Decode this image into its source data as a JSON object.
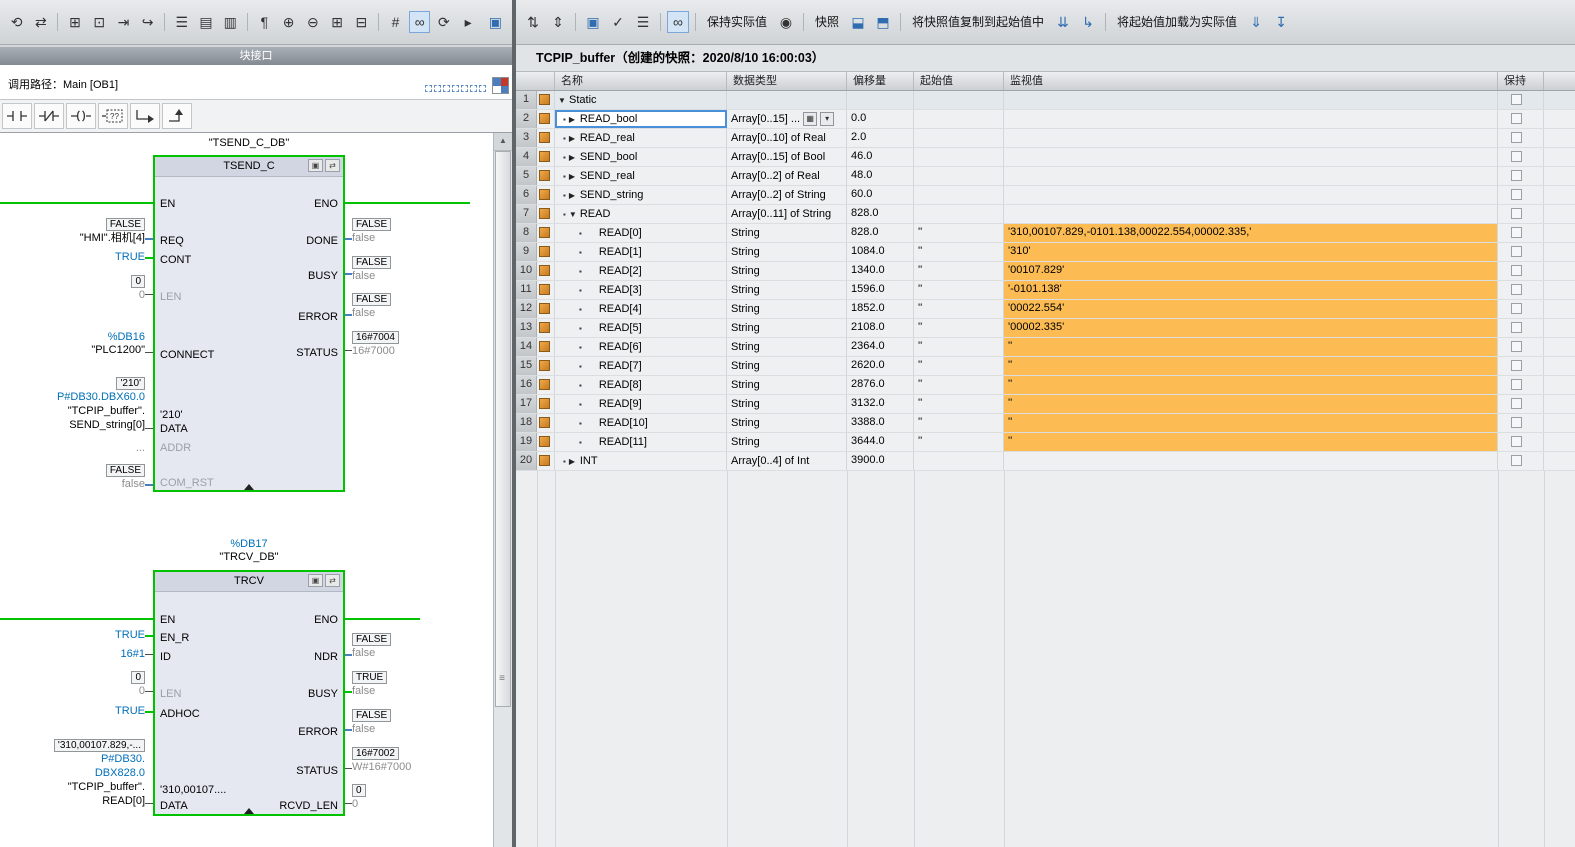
{
  "icons": {
    "update-call": "⟲",
    "consistency": "⇄",
    "insert-network": "⊞",
    "insert-box": "⊡",
    "goto": "⇥",
    "navigate": "↪",
    "align-left": "☰",
    "align-center": "▤",
    "align-right": "▥",
    "comment": "¶",
    "expand-all": "⊕",
    "collapse-all": "⊖",
    "expand-boxes": "⊞",
    "collapse-boxes": "⊟",
    "abs-operands": "#",
    "monitor": "∞",
    "refresh": "⟳",
    "more": "▸",
    "editor-settings": "▣",
    "sort-up": "⇅",
    "sort-down": "⇕",
    "keep-cube": "▣",
    "apply-check": "✓",
    "list": "☰",
    "lock": "◉",
    "snapshot-make": "⬓",
    "snapshot-load": "⬒",
    "copy-1": "⇊",
    "copy-2": "↳",
    "load-1": "⇓",
    "load-2": "↧",
    "camera": "▣",
    "plug": "⇄",
    "up-arrow": "▲",
    "grip": "≡"
  },
  "left_panel": {
    "interface_bar_label": "块接口",
    "call_path": "调用路径：Main [OB1]",
    "favorites": {
      "empty_box_label": "??"
    },
    "ladder": {
      "tsend": {
        "instance": "\"TSEND_C_DB\"",
        "title": "TSEND_C",
        "pins_left": [
          "EN",
          "REQ",
          "CONT",
          "LEN",
          "CONNECT",
          "DATA",
          "ADDR",
          "COM_RST"
        ],
        "pins_right": [
          "ENO",
          "DONE",
          "BUSY",
          "ERROR",
          "STATUS"
        ],
        "inline_data_value": "'210'",
        "req": {
          "box": "FALSE",
          "name": "\"HMI\".相机[4]"
        },
        "cont": "TRUE",
        "len": {
          "box": "0",
          "sub": "0"
        },
        "connect": {
          "db": "%DB16",
          "name": "\"PLC1200\""
        },
        "data": {
          "box": "'210'",
          "ptr": "P#DB30.DBX60.0",
          "l1": "\"TCPIP_buffer\".",
          "l2": "SEND_string[0]"
        },
        "addr": "...",
        "com_rst": {
          "box": "FALSE",
          "sub": "false"
        },
        "done": {
          "box": "FALSE",
          "sub": "false"
        },
        "busy": {
          "box": "FALSE",
          "sub": "false"
        },
        "error": {
          "box": "FALSE",
          "sub": "false"
        },
        "status": {
          "box": "16#7004",
          "sub": "16#7000"
        }
      },
      "trcv": {
        "db": "%DB17",
        "instance": "\"TRCV_DB\"",
        "title": "TRCV",
        "pins_left": [
          "EN",
          "EN_R",
          "ID",
          "LEN",
          "ADHOC",
          "DATA"
        ],
        "pins_right": [
          "ENO",
          "NDR",
          "BUSY",
          "ERROR",
          "STATUS",
          "RCVD_LEN"
        ],
        "inline_data_value": "'310,00107....",
        "en_r": "TRUE",
        "id": "16#1",
        "len": {
          "box": "0",
          "sub": "0"
        },
        "adhoc": "TRUE",
        "data": {
          "box": "'310,00107.829,-...",
          "p1": "P#DB30.",
          "p2": "DBX828.0",
          "l1": "\"TCPIP_buffer\".",
          "l2": "READ[0]"
        },
        "ndr": {
          "box": "FALSE",
          "sub": "false"
        },
        "busy": {
          "box": "TRUE",
          "sub": "false"
        },
        "error": {
          "box": "FALSE",
          "sub": "false"
        },
        "status": {
          "box": "16#7002",
          "sub": "W#16#7000"
        },
        "rcvd_len": {
          "box": "0",
          "sub": "0"
        }
      }
    }
  },
  "right_panel": {
    "toolbar": {
      "keep_actual": "保持实际值",
      "snapshot": "快照",
      "copy_snapshot_to_start": "将快照值复制到起始值中",
      "load_start_as_actual": "将起始值加载为实际值"
    },
    "title": "TCPIP_buffer（创建的快照：2020/8/10 16:00:03）",
    "table": {
      "headers": {
        "name": "名称",
        "datatype": "数据类型",
        "offset": "偏移量",
        "start": "起始值",
        "monitor": "监视值",
        "retain": "保持"
      },
      "rows": [
        {
          "num": "1",
          "level": 0,
          "expander": "down",
          "name": "Static",
          "datatype": "",
          "offset": "",
          "start": "",
          "monitor": "",
          "tint": true
        },
        {
          "num": "2",
          "level": 1,
          "bullet": true,
          "expander": "right",
          "name": "READ_bool",
          "datatype": "Array[0..15] ...",
          "offset": "0.0",
          "start": "",
          "monitor": "",
          "selected": true,
          "combo": true
        },
        {
          "num": "3",
          "level": 1,
          "bullet": true,
          "expander": "right",
          "name": "READ_real",
          "datatype": "Array[0..10] of Real",
          "offset": "2.0",
          "start": "",
          "monitor": ""
        },
        {
          "num": "4",
          "level": 1,
          "bullet": true,
          "expander": "right",
          "name": "SEND_bool",
          "datatype": "Array[0..15] of Bool",
          "offset": "46.0",
          "start": "",
          "monitor": ""
        },
        {
          "num": "5",
          "level": 1,
          "bullet": true,
          "expander": "right",
          "name": "SEND_real",
          "datatype": "Array[0..2] of Real",
          "offset": "48.0",
          "start": "",
          "monitor": ""
        },
        {
          "num": "6",
          "level": 1,
          "bullet": true,
          "expander": "right",
          "name": "SEND_string",
          "datatype": "Array[0..2] of String",
          "offset": "60.0",
          "start": "",
          "monitor": ""
        },
        {
          "num": "7",
          "level": 1,
          "bullet": true,
          "expander": "down",
          "name": "READ",
          "datatype": "Array[0..11] of String",
          "offset": "828.0",
          "start": "",
          "monitor": ""
        },
        {
          "num": "8",
          "level": 2,
          "bullet": true,
          "name": "READ[0]",
          "datatype": "String",
          "offset": "828.0",
          "start": "''",
          "monitor": "'310,00107.829,-0101.138,00022.554,00002.335,'",
          "highlight": true
        },
        {
          "num": "9",
          "level": 2,
          "bullet": true,
          "name": "READ[1]",
          "datatype": "String",
          "offset": "1084.0",
          "start": "''",
          "monitor": "'310'",
          "highlight": true
        },
        {
          "num": "10",
          "level": 2,
          "bullet": true,
          "name": "READ[2]",
          "datatype": "String",
          "offset": "1340.0",
          "start": "''",
          "monitor": "'00107.829'",
          "highlight": true
        },
        {
          "num": "11",
          "level": 2,
          "bullet": true,
          "name": "READ[3]",
          "datatype": "String",
          "offset": "1596.0",
          "start": "''",
          "monitor": "'-0101.138'",
          "highlight": true
        },
        {
          "num": "12",
          "level": 2,
          "bullet": true,
          "name": "READ[4]",
          "datatype": "String",
          "offset": "1852.0",
          "start": "''",
          "monitor": "'00022.554'",
          "highlight": true
        },
        {
          "num": "13",
          "level": 2,
          "bullet": true,
          "name": "READ[5]",
          "datatype": "String",
          "offset": "2108.0",
          "start": "''",
          "monitor": "'00002.335'",
          "highlight": true
        },
        {
          "num": "14",
          "level": 2,
          "bullet": true,
          "name": "READ[6]",
          "datatype": "String",
          "offset": "2364.0",
          "start": "''",
          "monitor": "''",
          "highlight": true
        },
        {
          "num": "15",
          "level": 2,
          "bullet": true,
          "name": "READ[7]",
          "datatype": "String",
          "offset": "2620.0",
          "start": "''",
          "monitor": "''",
          "highlight": true
        },
        {
          "num": "16",
          "level": 2,
          "bullet": true,
          "name": "READ[8]",
          "datatype": "String",
          "offset": "2876.0",
          "start": "''",
          "monitor": "''",
          "highlight": true
        },
        {
          "num": "17",
          "level": 2,
          "bullet": true,
          "name": "READ[9]",
          "datatype": "String",
          "offset": "3132.0",
          "start": "''",
          "monitor": "''",
          "highlight": true
        },
        {
          "num": "18",
          "level": 2,
          "bullet": true,
          "name": "READ[10]",
          "datatype": "String",
          "offset": "3388.0",
          "start": "''",
          "monitor": "''",
          "highlight": true
        },
        {
          "num": "19",
          "level": 2,
          "bullet": true,
          "name": "READ[11]",
          "datatype": "String",
          "offset": "3644.0",
          "start": "''",
          "monitor": "''",
          "highlight": true
        },
        {
          "num": "20",
          "level": 1,
          "bullet": true,
          "expander": "right",
          "name": "INT",
          "datatype": "Array[0..4] of Int",
          "offset": "3900.0",
          "start": "",
          "monitor": ""
        }
      ]
    }
  }
}
